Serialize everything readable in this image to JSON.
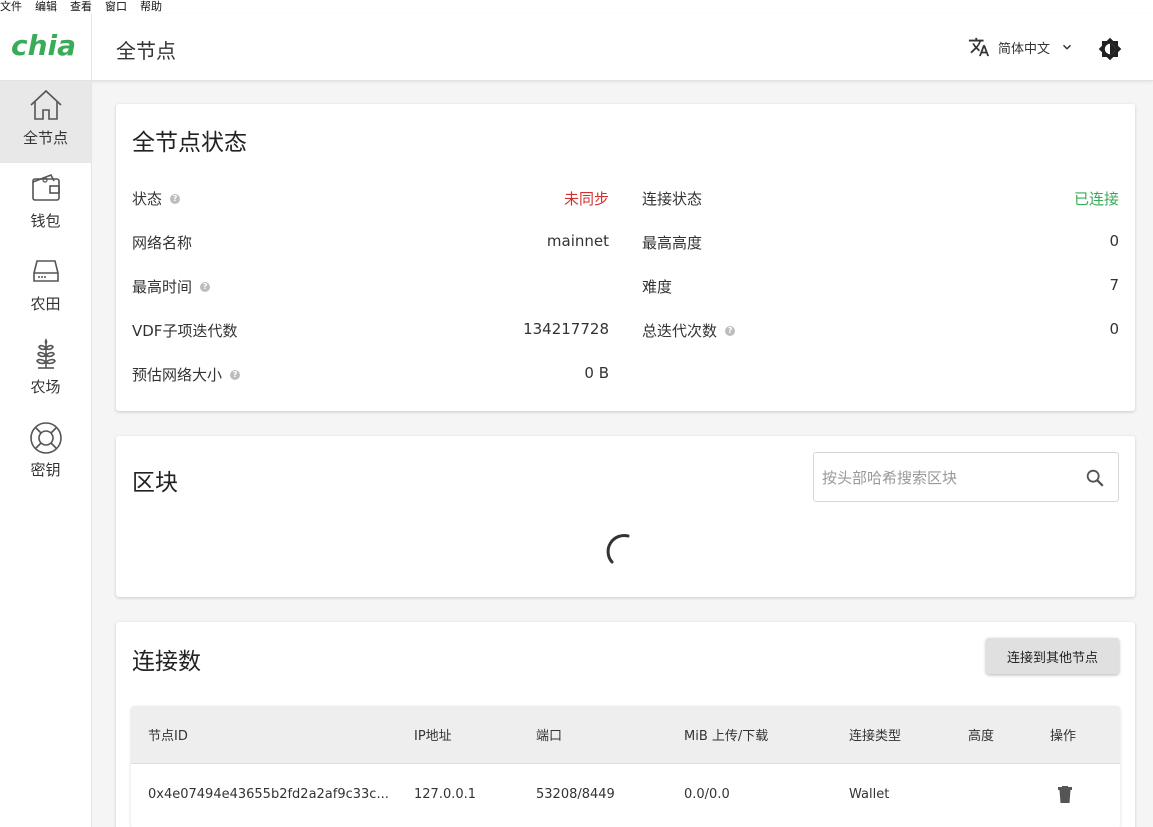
{
  "menu": [
    "文件",
    "编辑",
    "查看",
    "窗口",
    "帮助"
  ],
  "header": {
    "logo_text": "chia",
    "title": "全节点",
    "language": "简体中文"
  },
  "sidebar": {
    "items": [
      {
        "label": "全节点",
        "icon": "home-icon",
        "active": true
      },
      {
        "label": "钱包",
        "icon": "wallet-icon"
      },
      {
        "label": "农田",
        "icon": "drive-icon"
      },
      {
        "label": "农场",
        "icon": "sprout-icon"
      },
      {
        "label": "密钥",
        "icon": "lifebuoy-icon"
      }
    ]
  },
  "status": {
    "title": "全节点状态",
    "left": [
      {
        "label": "状态",
        "value": "未同步",
        "help": true
      },
      {
        "label": "网络名称",
        "value": "mainnet"
      },
      {
        "label": "最高时间",
        "value": "",
        "help": true
      },
      {
        "label": "VDF子项迭代数",
        "value": "134217728"
      },
      {
        "label": "预估网络大小",
        "value": "0 B",
        "help": true
      }
    ],
    "right": [
      {
        "label": "连接状态",
        "value": "已连接"
      },
      {
        "label": "最高高度",
        "value": "0"
      },
      {
        "label": "难度",
        "value": "7"
      },
      {
        "label": "总迭代次数",
        "value": "0",
        "help": true
      }
    ]
  },
  "blocks": {
    "title": "区块",
    "search_placeholder": "按头部哈希搜索区块"
  },
  "connections": {
    "title": "连接数",
    "connect_button": "连接到其他节点",
    "columns": [
      "节点ID",
      "IP地址",
      "端口",
      "MiB 上传/下载",
      "连接类型",
      "高度",
      "操作"
    ],
    "rows": [
      {
        "node_id": "0x4e07494e43655b2fd2a2af9c33c...",
        "ip": "127.0.0.1",
        "port": "53208/8449",
        "transfer": "0.0/0.0",
        "type": "Wallet",
        "height": ""
      }
    ]
  },
  "colors": {
    "brand": "#3aac59",
    "error": "#d32f2f",
    "success": "#3aac59"
  }
}
